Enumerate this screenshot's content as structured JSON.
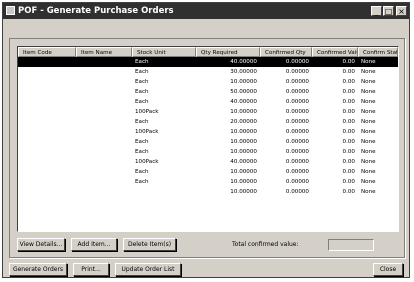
{
  "window": {
    "title": "POF - Generate Purchase Orders",
    "subtitle": "",
    "minimize_glyph": "_",
    "maximize_glyph": "□",
    "close_glyph": "×"
  },
  "table": {
    "columns": [
      "Item Code",
      "Item Name",
      "Stock Unit",
      "Qty Required",
      "Confirmed Qty",
      "Confirmed Value",
      "Confirm Status"
    ],
    "rows": [
      {
        "code": "",
        "name": "",
        "unit": "Each",
        "qty": "40.00000",
        "confirmed_qty": "0.00000",
        "value": "0.00",
        "status": "None"
      },
      {
        "code": "",
        "name": "",
        "unit": "Each",
        "qty": "30.00000",
        "confirmed_qty": "0.00000",
        "value": "0.00",
        "status": "None"
      },
      {
        "code": "",
        "name": "",
        "unit": "Each",
        "qty": "10.00000",
        "confirmed_qty": "0.00000",
        "value": "0.00",
        "status": "None"
      },
      {
        "code": "",
        "name": "",
        "unit": "Each",
        "qty": "50.00000",
        "confirmed_qty": "0.00000",
        "value": "0.00",
        "status": "None"
      },
      {
        "code": "",
        "name": "",
        "unit": "Each",
        "qty": "40.00000",
        "confirmed_qty": "0.00000",
        "value": "0.00",
        "status": "None"
      },
      {
        "code": "",
        "name": "",
        "unit": "100Pack",
        "qty": "10.00000",
        "confirmed_qty": "0.00000",
        "value": "0.00",
        "status": "None"
      },
      {
        "code": "",
        "name": "",
        "unit": "Each",
        "qty": "20.00000",
        "confirmed_qty": "0.00000",
        "value": "0.00",
        "status": "None"
      },
      {
        "code": "",
        "name": "",
        "unit": "100Pack",
        "qty": "10.00000",
        "confirmed_qty": "0.00000",
        "value": "0.00",
        "status": "None"
      },
      {
        "code": "",
        "name": "",
        "unit": "Each",
        "qty": "10.00000",
        "confirmed_qty": "0.00000",
        "value": "0.00",
        "status": "None"
      },
      {
        "code": "",
        "name": "",
        "unit": "Each",
        "qty": "10.00000",
        "confirmed_qty": "0.00000",
        "value": "0.00",
        "status": "None"
      },
      {
        "code": "",
        "name": "",
        "unit": "100Pack",
        "qty": "40.00000",
        "confirmed_qty": "0.00000",
        "value": "0.00",
        "status": "None"
      },
      {
        "code": "",
        "name": "",
        "unit": "Each",
        "qty": "10.00000",
        "confirmed_qty": "0.00000",
        "value": "0.00",
        "status": "None"
      },
      {
        "code": "",
        "name": "",
        "unit": "Each",
        "qty": "10.00000",
        "confirmed_qty": "0.00000",
        "value": "0.00",
        "status": "None"
      },
      {
        "code": "",
        "name": "",
        "unit": "",
        "qty": "10.00000",
        "confirmed_qty": "0.00000",
        "value": "0.00",
        "status": "None"
      }
    ]
  },
  "buttons": {
    "view_details": "View Details...",
    "add_item": "Add Item...",
    "delete_item": "Delete Item(s)",
    "generate_orders": "Generate Orders",
    "print": "Print...",
    "update_order_list": "Update Order List",
    "close": "Close"
  },
  "total": {
    "label": "Total confirmed value:",
    "value": ""
  }
}
